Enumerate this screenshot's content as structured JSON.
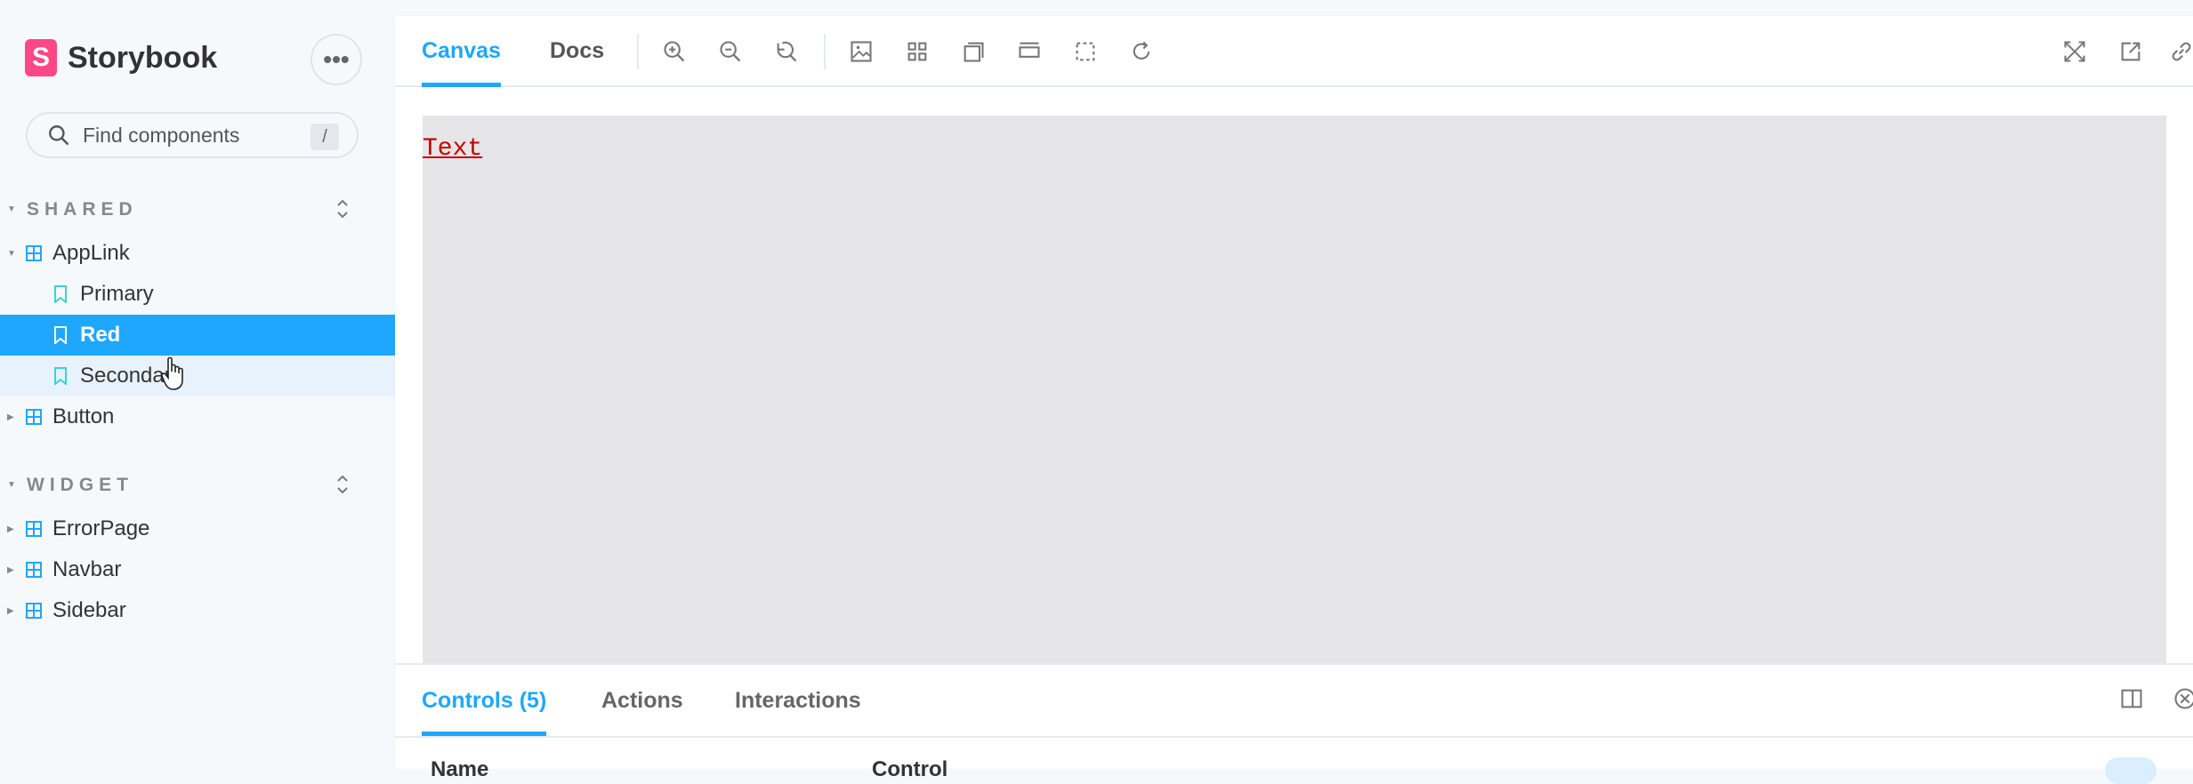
{
  "sidebar": {
    "brand": {
      "logo": "S",
      "name": "Storybook"
    },
    "menu_button": "•••",
    "search": {
      "placeholder": "Find components",
      "shortcut": "/"
    },
    "groups": [
      {
        "label": "SHARED",
        "items": [
          {
            "label": "AppLink",
            "type": "component",
            "expanded": true
          },
          {
            "label": "Primary",
            "type": "story"
          },
          {
            "label": "Red",
            "type": "story",
            "selected": true
          },
          {
            "label": "Secondary",
            "type": "story",
            "hovered": true
          },
          {
            "label": "Button",
            "type": "component",
            "expanded": false
          }
        ]
      },
      {
        "label": "WIDGET",
        "items": [
          {
            "label": "ErrorPage",
            "type": "component"
          },
          {
            "label": "Navbar",
            "type": "component"
          },
          {
            "label": "Sidebar",
            "type": "component"
          }
        ]
      }
    ]
  },
  "toolbar": {
    "tabs": [
      {
        "label": "Canvas",
        "active": true
      },
      {
        "label": "Docs",
        "active": false
      }
    ],
    "tools": [
      "zoom-in-icon",
      "zoom-out-icon",
      "zoom-reset-icon",
      "background-icon",
      "grid-icon",
      "viewport-icon",
      "measure-icon",
      "outline-icon",
      "remount-icon"
    ],
    "right_tools": [
      "fullscreen-icon",
      "open-new-tab-icon",
      "copy-link-icon"
    ]
  },
  "canvas": {
    "preview_text": "Text"
  },
  "addons": {
    "tabs": [
      {
        "label": "Controls (5)",
        "active": true
      },
      {
        "label": "Actions",
        "active": false
      },
      {
        "label": "Interactions",
        "active": false
      }
    ],
    "columns": [
      "Name",
      "Control"
    ]
  },
  "colors": {
    "accent": "#1ea7fd",
    "brand": "#ff4785",
    "preview_text": "#c40000",
    "canvas_bg": "#e6e5e8"
  }
}
